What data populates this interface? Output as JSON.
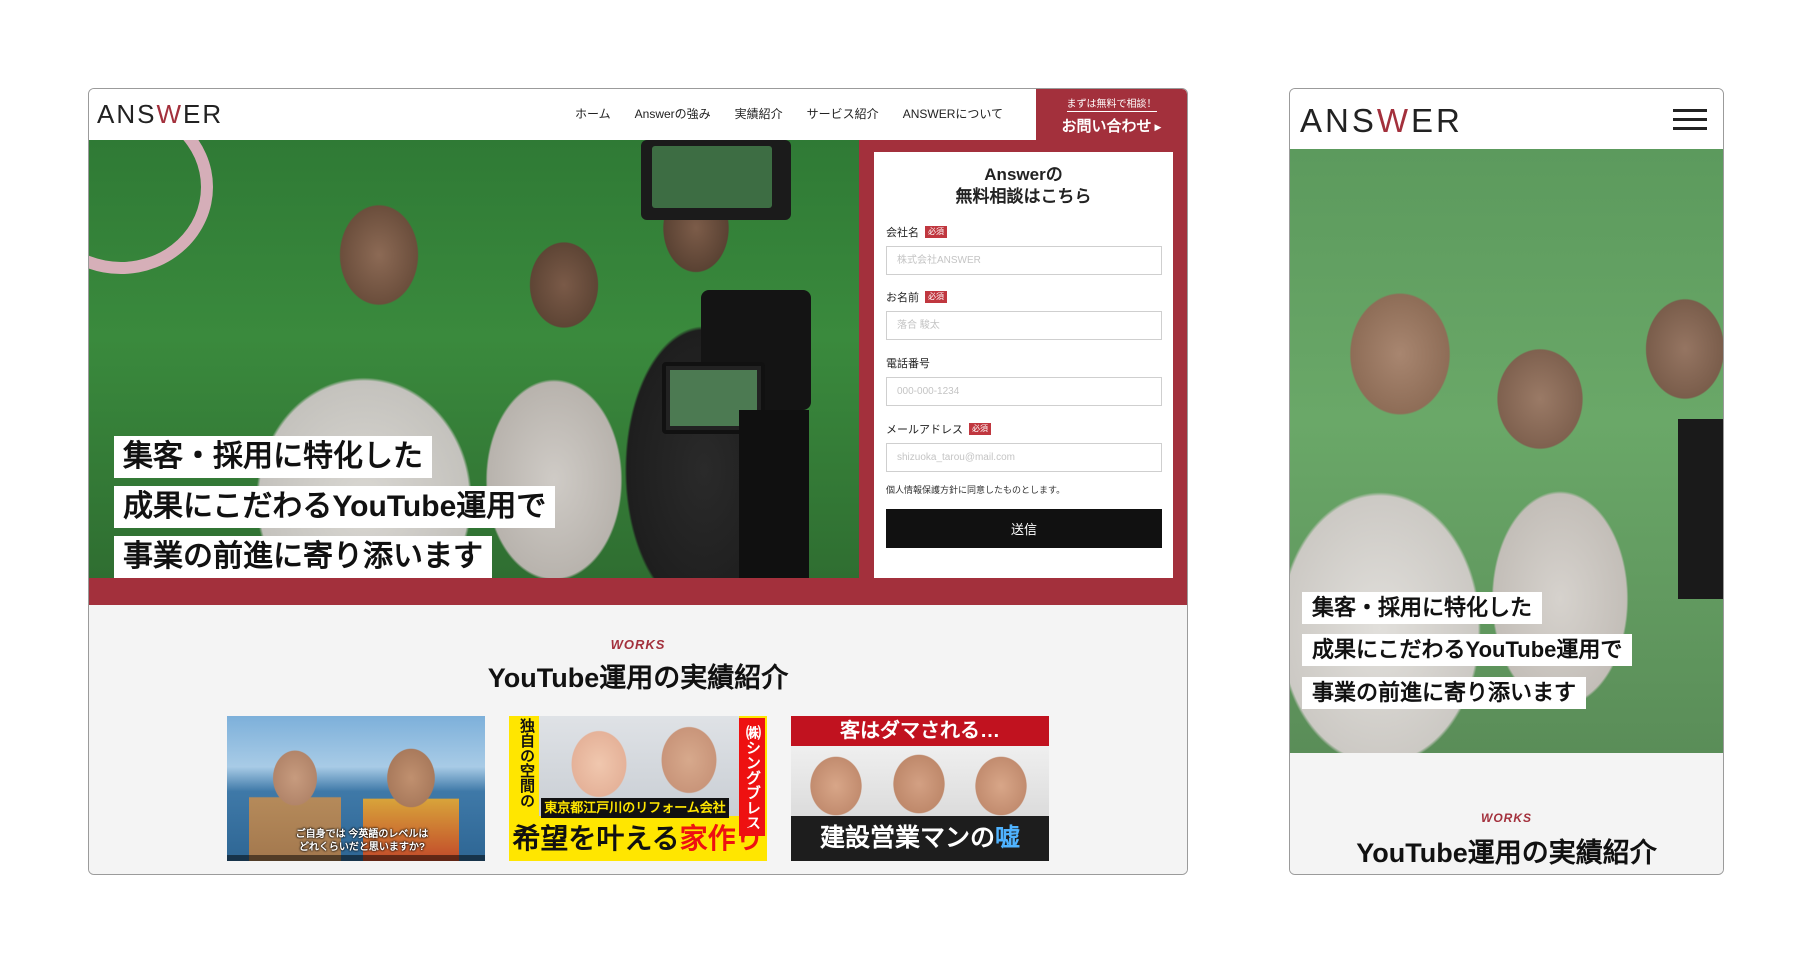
{
  "brand": {
    "logo_pre": "ANS",
    "logo_w": "W",
    "logo_post": "ER",
    "accent_color": "#a3303c"
  },
  "nav": {
    "items": [
      "ホーム",
      "Answerの強み",
      "実績紹介",
      "サービス紹介",
      "ANSWERについて"
    ],
    "cta_small": "まずは無料で相談！",
    "cta_big": "お問い合わせ",
    "cta_arrow": "▶"
  },
  "hero": {
    "lines": [
      "集客・採用に特化した",
      "成果にこだわるYouTube運用で",
      "事業の前進に寄り添います"
    ]
  },
  "form": {
    "title_line1": "Answerの",
    "title_line2": "無料相談はこちら",
    "required_label": "必須",
    "fields": [
      {
        "label": "会社名",
        "placeholder": "株式会社ANSWER"
      },
      {
        "label": "お名前",
        "placeholder": "落合 駿太"
      },
      {
        "label": "電話番号",
        "placeholder": "000-000-1234"
      },
      {
        "label": "メールアドレス",
        "placeholder": "shizuoka_tarou@mail.com"
      }
    ],
    "privacy": "個人情報保護方針に同意したものとします。",
    "submit": "送信"
  },
  "works": {
    "label": "WORKS",
    "title": "YouTube運用の実績紹介",
    "thumbs": {
      "t1_caption_1": "ご自身では 今英語のレベルは",
      "t1_caption_2": "どれくらいだと思いますか?",
      "t2_left": "独自の空間の見せ方",
      "t2_right": "㈱シングブレス",
      "t2_mid": "東京都江戸川のリフォーム会社",
      "t2_big_1": "希望を",
      "t2_big_2": "叶える",
      "t2_big_3": "家作り",
      "t3_banner": "客はダマされる…",
      "t3_big_1": "建設営業マンの",
      "t3_big_2": "嘘"
    }
  },
  "mobile": {
    "lines": [
      "集客・採用に特化した",
      "成果にこだわるYouTube運用で",
      "事業の前進に寄り添います"
    ],
    "works_label": "WORKS",
    "works_title": "YouTube運用の実績紹介"
  }
}
